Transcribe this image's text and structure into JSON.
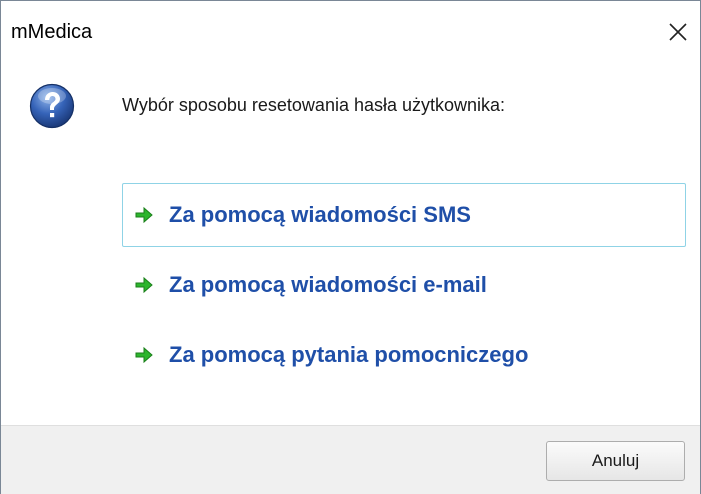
{
  "window": {
    "title": "mMedica",
    "close_icon": "close-icon"
  },
  "dialog": {
    "icon": "question-icon",
    "prompt": "Wybór sposobu resetowania hasła użytkownika:",
    "options": [
      {
        "label": "Za pomocą wiadomości SMS",
        "focused": true
      },
      {
        "label": "Za pomocą wiadomości e-mail",
        "focused": false
      },
      {
        "label": "Za pomocą pytania pomocniczego",
        "focused": false
      }
    ],
    "arrow_color": "#2db52d",
    "link_color": "#1f4fa8"
  },
  "footer": {
    "cancel_label": "Anuluj"
  }
}
